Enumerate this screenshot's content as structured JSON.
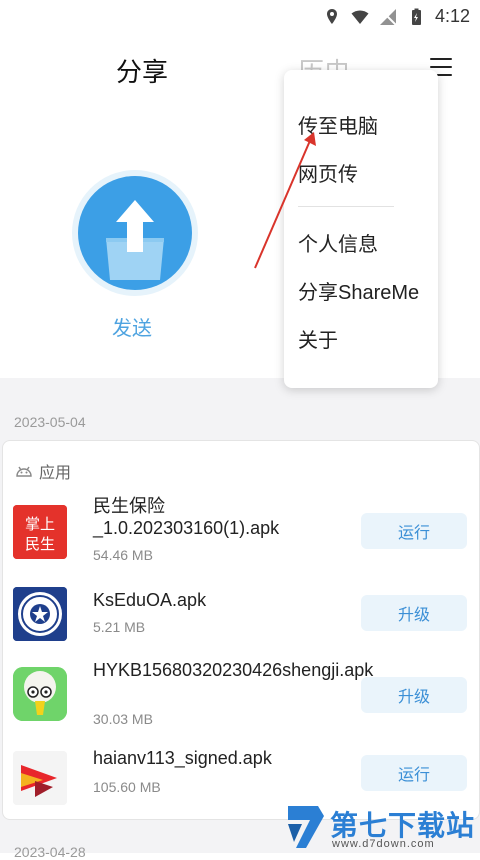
{
  "status_bar": {
    "time": "4:12",
    "icons": [
      "location-icon",
      "wifi-icon",
      "no-signal-icon",
      "battery-charging-icon"
    ]
  },
  "header": {
    "tab_share": "分享",
    "tab_history": "历史",
    "menu_icon": "hamburger-menu-icon"
  },
  "send": {
    "label": "发送",
    "icon": "upload-icon"
  },
  "history": {
    "date": "2023-05-04",
    "section_label": "应用",
    "section_icon": "android-icon",
    "apps": [
      {
        "name": "民生保险_1.0.202303160(1).apk",
        "size": "54.46 MB",
        "action": "运行",
        "icon_text": [
          "掌上",
          "民生"
        ]
      },
      {
        "name": "KsEduOA.apk",
        "size": "5.21 MB",
        "action": "升级"
      },
      {
        "name": "HYKB15680320230426shengji.apk",
        "size": "30.03 MB",
        "action": "升级"
      },
      {
        "name": "haianv113_signed.apk",
        "size": "105.60 MB",
        "action": "运行"
      }
    ],
    "next_date": "2023-04-28"
  },
  "menu": {
    "items": [
      "传至电脑",
      "网页传",
      "个人信息",
      "分享ShareMe",
      "关于"
    ]
  },
  "watermark": {
    "text": "第七下载站",
    "url": "www.d7down.com"
  },
  "colors": {
    "accent": "#3c9fe6",
    "button_bg": "#eaf4fb",
    "button_text": "#3b8fd6",
    "annotation": "#d9342b"
  }
}
